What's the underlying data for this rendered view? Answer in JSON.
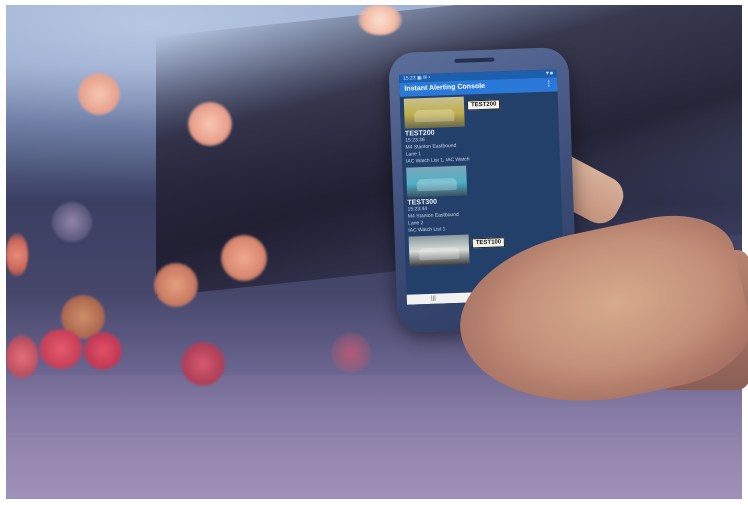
{
  "app": {
    "status_time": "15:23",
    "status_icons": "▣ ✉ •",
    "status_right": "▼■",
    "title": "Instant Alerting Console",
    "menu_icon": "vertical-dots-icon"
  },
  "alerts": [
    {
      "plate": "TEST200",
      "reg": "TEST200",
      "time": "15:23:36",
      "location": "M4 Stanton Eastbound",
      "lane": "Lane 1",
      "lists": "IAC Watch List 1, IAC Watch"
    },
    {
      "plate": "",
      "reg": "TEST300",
      "time": "15:23:44",
      "location": "M4 Stanton Eastbound",
      "lane": "Lane 2",
      "lists": "IAC Watch List 1"
    },
    {
      "plate": "TEST100",
      "reg": "",
      "time": "",
      "location": "",
      "lane": "",
      "lists": ""
    }
  ],
  "navbar": {
    "recent": "|||",
    "home": "○",
    "back": "<"
  },
  "colors": {
    "app_bar": "#2a79d8",
    "status_bar": "#1b5fae",
    "feed_bg": "#23406b"
  }
}
